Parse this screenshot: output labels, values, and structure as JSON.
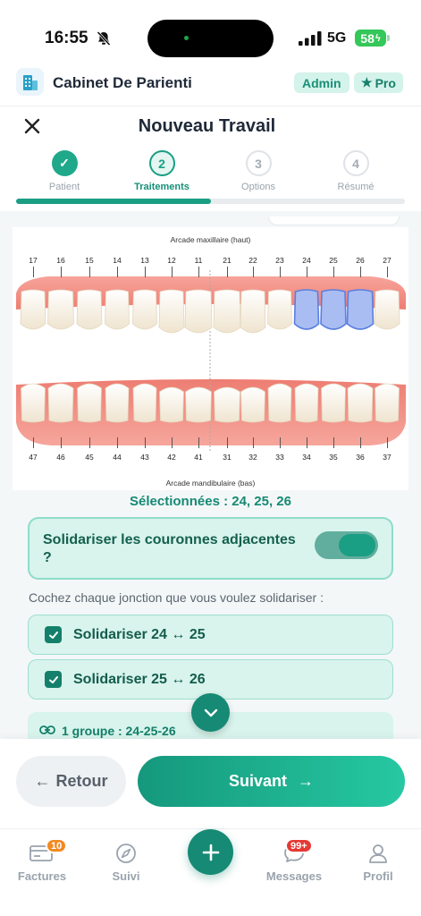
{
  "status_bar": {
    "time": "16:55",
    "network": "5G",
    "battery": "58"
  },
  "app": {
    "name": "Cabinet De Parienti",
    "badge_admin": "Admin",
    "badge_pro": "Pro",
    "badge_pro_icon": "star-icon"
  },
  "page": {
    "title": "Nouveau Travail"
  },
  "stepper": {
    "progress_fraction": 0.5,
    "steps": [
      {
        "number": "1",
        "label": "Patient",
        "state": "done"
      },
      {
        "number": "2",
        "label": "Traitements",
        "state": "active"
      },
      {
        "number": "3",
        "label": "Options",
        "state": "todo"
      },
      {
        "number": "4",
        "label": "Résumé",
        "state": "todo"
      }
    ]
  },
  "dental_chart": {
    "upper_title": "Arcade maxillaire (haut)",
    "lower_title": "Arcade mandibulaire (bas)",
    "upper_numbers": [
      "17",
      "16",
      "15",
      "14",
      "13",
      "12",
      "11",
      "21",
      "22",
      "23",
      "24",
      "25",
      "26",
      "27"
    ],
    "lower_numbers": [
      "47",
      "46",
      "45",
      "44",
      "43",
      "42",
      "41",
      "31",
      "32",
      "33",
      "34",
      "35",
      "36",
      "37"
    ],
    "selected_teeth": [
      "24",
      "25",
      "26"
    ],
    "highlight_color": "#5b7fe0"
  },
  "selection": {
    "text": "Sélectionnées : 24, 25, 26"
  },
  "solidarise": {
    "label": "Solidariser les couronnes adjacentes ?",
    "enabled": true
  },
  "hint": "Cochez chaque jonction que vous voulez solidariser :",
  "junctions": [
    {
      "label": "Solidariser 24 ↔ 25",
      "checked": true
    },
    {
      "label": "Solidariser 25 ↔ 26",
      "checked": true
    }
  ],
  "group": {
    "text": "1 groupe : 24-25-26"
  },
  "buttons": {
    "back": "Retour",
    "next": "Suivant"
  },
  "tabs": [
    {
      "label": "Factures",
      "badge": "10",
      "icon": "invoice-icon"
    },
    {
      "label": "Suivi",
      "icon": "navigation-icon"
    },
    {
      "label": "Messages",
      "badge": "99+",
      "icon": "chat-icon"
    },
    {
      "label": "Profil",
      "icon": "user-icon"
    }
  ],
  "colors": {
    "accent": "#1a9e84",
    "accent_dark": "#168a74",
    "badge_orange": "#f08a24",
    "badge_red": "#e53935"
  }
}
